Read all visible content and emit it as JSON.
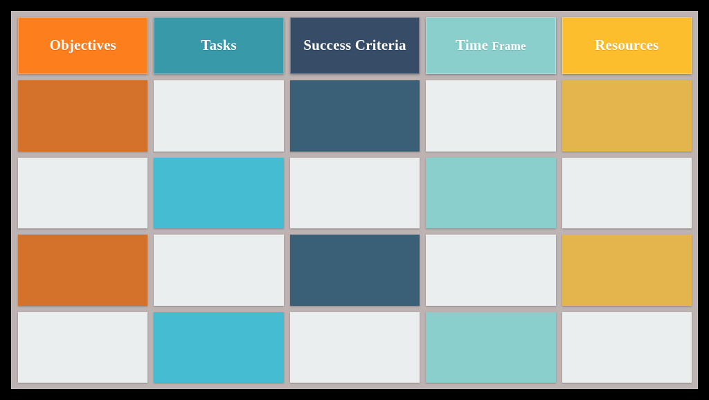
{
  "document": {
    "title": "Planning Matrix Table",
    "layout": "grid",
    "columns": 5,
    "rows": 5,
    "header_rows": 1,
    "body_rows": 4
  },
  "palette": {
    "stage_background": "#000000",
    "frame_background": "#bcb3b2",
    "empty_cell": "#ebeeef",
    "header_objectives": "#fd7e1d",
    "header_tasks": "#3899a8",
    "header_success_criteria": "#374c66",
    "header_time_frame": "#8acfcc",
    "header_resources": "#fdbe2e",
    "body_objectives": "#d4722c",
    "body_tasks": "#45bcd1",
    "body_success_criteria": "#396077",
    "body_time_frame": "#8acfcc",
    "body_resources": "#e5b54d",
    "header_text": "#ffffff"
  },
  "table": {
    "headers": [
      {
        "id": "objectives",
        "label": "Objectives",
        "label_main": "Objectives",
        "label_secondary": "",
        "color": "#fd7e1d"
      },
      {
        "id": "tasks",
        "label": "Tasks",
        "label_main": "Tasks",
        "label_secondary": "",
        "color": "#3899a8"
      },
      {
        "id": "success-criteria",
        "label": "Success Criteria",
        "label_main": "Success Criteria",
        "label_secondary": "",
        "color": "#374c66"
      },
      {
        "id": "time-frame",
        "label": "Time Frame",
        "label_main": "Time",
        "label_secondary": "Frame",
        "color": "#8acfcc"
      },
      {
        "id": "resources",
        "label": "Resources",
        "label_main": "Resources",
        "label_secondary": "",
        "color": "#fdbe2e"
      }
    ],
    "body_rows": [
      {
        "row_index": 1,
        "cells": [
          {
            "column": "objectives",
            "text": "",
            "filled": true,
            "color": "#d4722c"
          },
          {
            "column": "tasks",
            "text": "",
            "filled": false,
            "color": "#ebeeef"
          },
          {
            "column": "success-criteria",
            "text": "",
            "filled": true,
            "color": "#396077"
          },
          {
            "column": "time-frame",
            "text": "",
            "filled": false,
            "color": "#ebeeef"
          },
          {
            "column": "resources",
            "text": "",
            "filled": true,
            "color": "#e5b54d"
          }
        ]
      },
      {
        "row_index": 2,
        "cells": [
          {
            "column": "objectives",
            "text": "",
            "filled": false,
            "color": "#ebeeef"
          },
          {
            "column": "tasks",
            "text": "",
            "filled": true,
            "color": "#45bcd1"
          },
          {
            "column": "success-criteria",
            "text": "",
            "filled": false,
            "color": "#ebeeef"
          },
          {
            "column": "time-frame",
            "text": "",
            "filled": true,
            "color": "#8acfcc"
          },
          {
            "column": "resources",
            "text": "",
            "filled": false,
            "color": "#ebeeef"
          }
        ]
      },
      {
        "row_index": 3,
        "cells": [
          {
            "column": "objectives",
            "text": "",
            "filled": true,
            "color": "#d4722c"
          },
          {
            "column": "tasks",
            "text": "",
            "filled": false,
            "color": "#ebeeef"
          },
          {
            "column": "success-criteria",
            "text": "",
            "filled": true,
            "color": "#396077"
          },
          {
            "column": "time-frame",
            "text": "",
            "filled": false,
            "color": "#ebeeef"
          },
          {
            "column": "resources",
            "text": "",
            "filled": true,
            "color": "#e5b54d"
          }
        ]
      },
      {
        "row_index": 4,
        "cells": [
          {
            "column": "objectives",
            "text": "",
            "filled": false,
            "color": "#ebeeef"
          },
          {
            "column": "tasks",
            "text": "",
            "filled": true,
            "color": "#45bcd1"
          },
          {
            "column": "success-criteria",
            "text": "",
            "filled": false,
            "color": "#ebeeef"
          },
          {
            "column": "time-frame",
            "text": "",
            "filled": true,
            "color": "#8acfcc"
          },
          {
            "column": "resources",
            "text": "",
            "filled": false,
            "color": "#ebeeef"
          }
        ]
      }
    ]
  }
}
